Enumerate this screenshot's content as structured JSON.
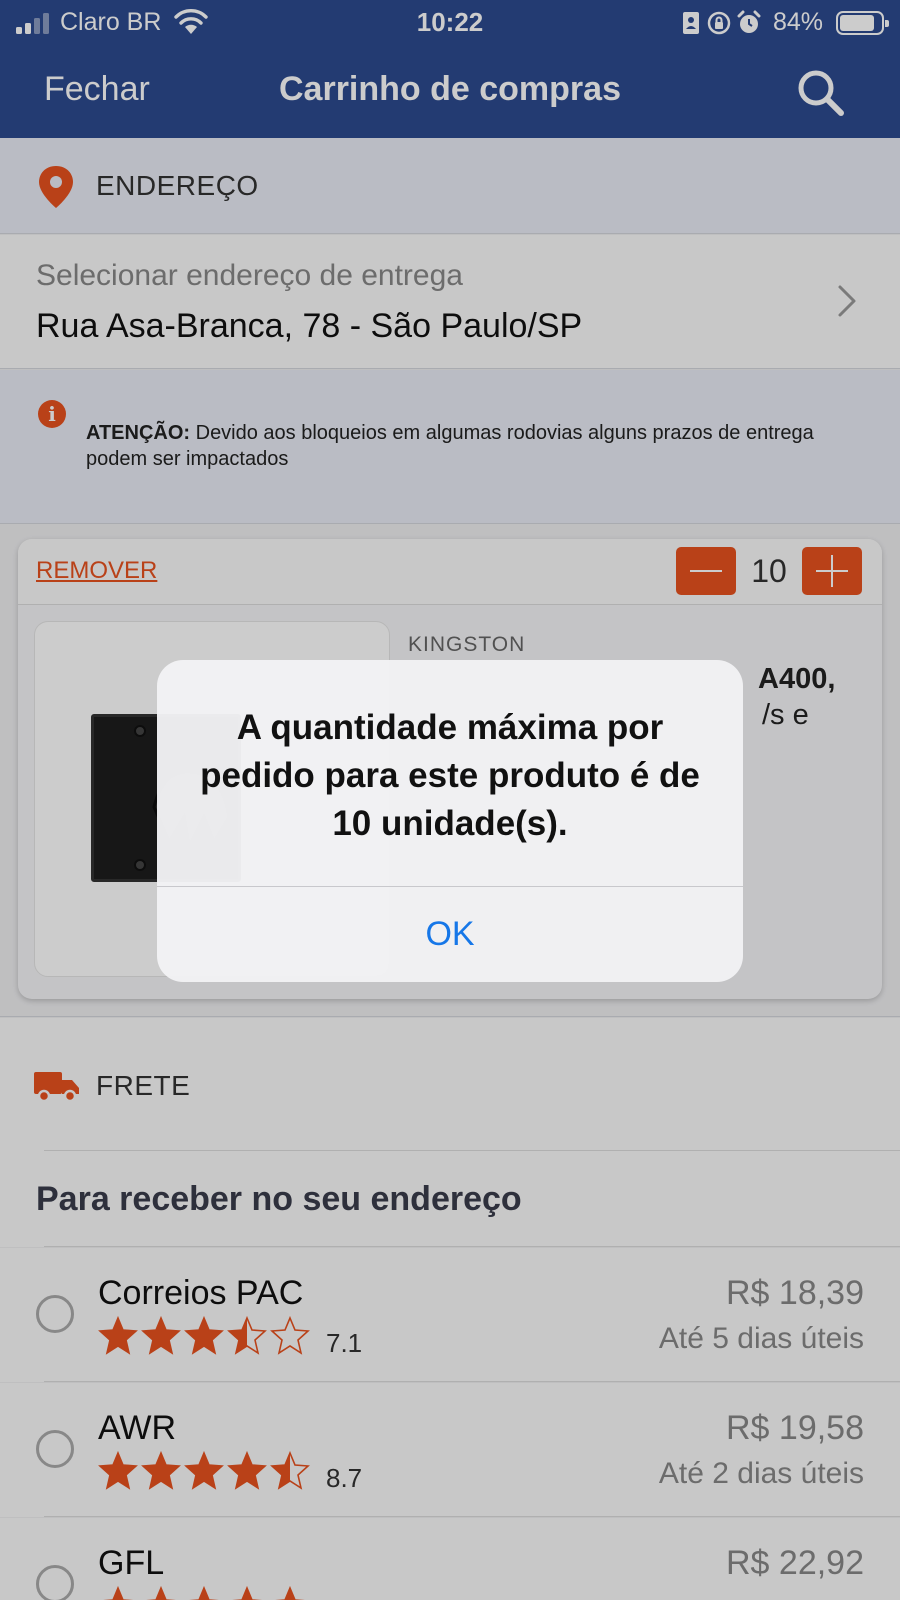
{
  "status_bar": {
    "carrier": "Claro BR",
    "time": "10:22",
    "battery": "84%",
    "battery_level": 0.84
  },
  "nav": {
    "close_label": "Fechar",
    "title": "Carrinho de compras",
    "search_icon": "search-icon"
  },
  "address": {
    "section_label": "ENDEREÇO",
    "select_label": "Selecionar endereço de entrega",
    "current": "Rua Asa-Branca, 78 - São Paulo/SP"
  },
  "notice": {
    "prefix": "ATENÇÃO:",
    "text": " Devido aos bloqueios em algumas rodovias alguns prazos de entrega podem ser impactados"
  },
  "cart_item": {
    "remove_label": "REMOVER",
    "quantity": "10",
    "brand": "KINGSTON",
    "name_visible": "A400,",
    "name_visible_2": "/s e"
  },
  "shipping": {
    "section_label": "FRETE",
    "subtitle": "Para receber no seu endereço",
    "options": [
      {
        "name": "Correios PAC",
        "rating": "7.1",
        "stars": 3.5,
        "price": "R$ 18,39",
        "eta": "Até 5 dias úteis"
      },
      {
        "name": "AWR",
        "rating": "8.7",
        "stars": 4.5,
        "price": "R$ 19,58",
        "eta": "Até 2 dias úteis"
      },
      {
        "name": "GFL",
        "rating": "",
        "stars": 5,
        "price": "R$ 22,92",
        "eta": ""
      }
    ]
  },
  "dialog": {
    "message": "A quantidade máxima por pedido para este produto é de 10 unidade(s).",
    "ok_label": "OK"
  },
  "colors": {
    "nav_bg": "#2c4a8f",
    "accent": "#e8521f",
    "link_blue": "#1677e8"
  }
}
